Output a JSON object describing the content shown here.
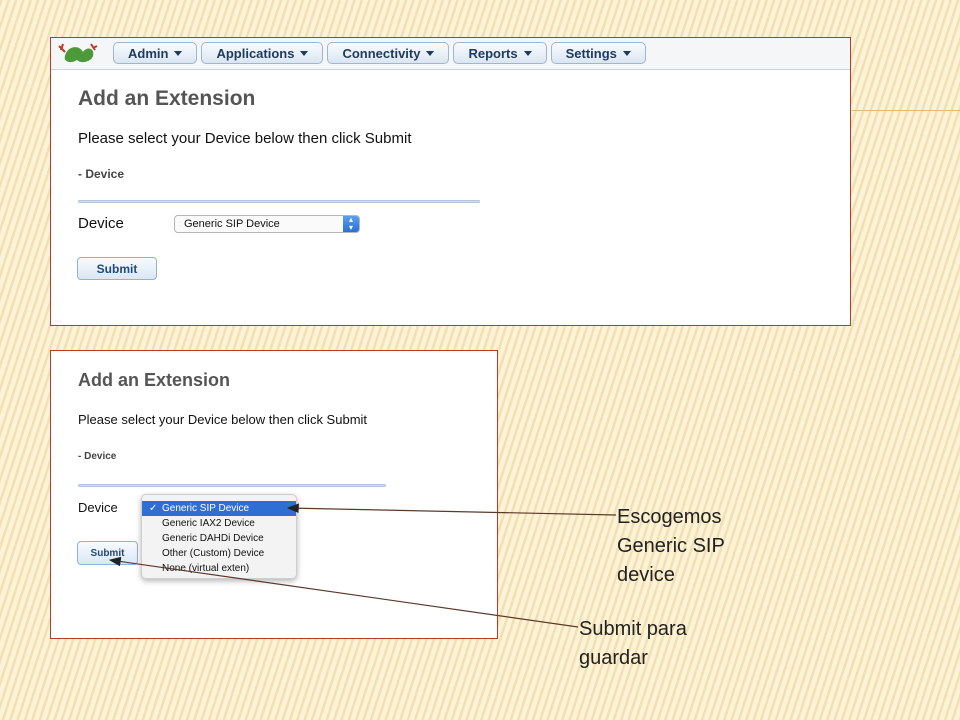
{
  "navbar": {
    "menus": [
      {
        "label": "Admin"
      },
      {
        "label": "Applications"
      },
      {
        "label": "Connectivity"
      },
      {
        "label": "Reports"
      },
      {
        "label": "Settings"
      }
    ]
  },
  "form": {
    "title": "Add an Extension",
    "instruction": "Please select your Device below then click Submit",
    "section": "- Device",
    "device_label": "Device",
    "device_selected": "Generic SIP Device",
    "submit_label": "Submit"
  },
  "dropdown": {
    "options": [
      {
        "label": "Generic SIP Device"
      },
      {
        "label": "Generic IAX2 Device"
      },
      {
        "label": "Generic DAHDi Device"
      },
      {
        "label": "Other (Custom) Device"
      },
      {
        "label": "None (virtual exten)"
      }
    ],
    "check": "✓"
  },
  "annotations": {
    "choose_line1": "Escogemos",
    "choose_line2": "Generic SIP",
    "choose_line3": "device",
    "submit_line1": "Submit para",
    "submit_line2": "guardar"
  },
  "colors": {
    "frame_border": "#b83a2c",
    "menu_text": "#1f3a5e",
    "selected_option": "#2f6ed3"
  }
}
